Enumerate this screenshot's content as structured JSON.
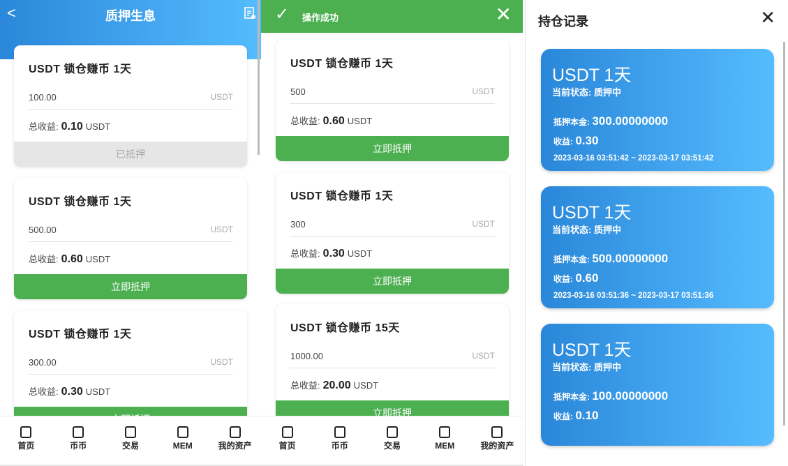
{
  "left": {
    "title": "质押生息",
    "back": "<",
    "cards": [
      {
        "title": "USDT 锁仓赚币 1天",
        "amount": "100.00",
        "unit": "USDT",
        "income_label": "总收益:",
        "income": "0.10",
        "income_unit": "USDT",
        "button": "已抵押",
        "done": true
      },
      {
        "title": "USDT 锁仓赚币 1天",
        "amount": "500.00",
        "unit": "USDT",
        "income_label": "总收益:",
        "income": "0.60",
        "income_unit": "USDT",
        "button": "立即抵押",
        "done": false
      },
      {
        "title": "USDT 锁仓赚币 1天",
        "amount": "300.00",
        "unit": "USDT",
        "income_label": "总收益:",
        "income": "0.30",
        "income_unit": "USDT",
        "button": "立即抵押",
        "done": false
      }
    ]
  },
  "middle": {
    "toast": "操作成功",
    "toast_icon": "✓",
    "close": "✕",
    "cards": [
      {
        "title": "USDT 锁仓赚币 1天",
        "amount": "500",
        "unit": "USDT",
        "income_label": "总收益:",
        "income": "0.60",
        "income_unit": "USDT",
        "button": "立即抵押",
        "done": false
      },
      {
        "title": "USDT 锁仓赚币 1天",
        "amount": "300",
        "unit": "USDT",
        "income_label": "总收益:",
        "income": "0.30",
        "income_unit": "USDT",
        "button": "立即抵押",
        "done": false
      },
      {
        "title": "USDT 锁仓赚币 15天",
        "amount": "1000.00",
        "unit": "USDT",
        "income_label": "总收益:",
        "income": "20.00",
        "income_unit": "USDT",
        "button": "立即抵押",
        "done": false
      }
    ]
  },
  "nav": [
    {
      "label": "首页",
      "icon": "home-icon"
    },
    {
      "label": "币币",
      "icon": "exchange-icon"
    },
    {
      "label": "交易",
      "icon": "trade-icon"
    },
    {
      "label": "MEM",
      "icon": "mem-icon"
    },
    {
      "label": "我的资产",
      "icon": "wallet-icon"
    }
  ],
  "right": {
    "title": "持仓记录",
    "close": "✕",
    "records": [
      {
        "name": "USDT 1天",
        "status": "当前状态: 质押中",
        "principal_label": "抵押本金:",
        "principal": "300.00000000",
        "income_label": "收益:",
        "income": "0.30",
        "period": "2023-03-16 03:51:42 ~ 2023-03-17 03:51:42"
      },
      {
        "name": "USDT 1天",
        "status": "当前状态: 质押中",
        "principal_label": "抵押本金:",
        "principal": "500.00000000",
        "income_label": "收益:",
        "income": "0.60",
        "period": "2023-03-16 03:51:36 ~ 2023-03-17 03:51:36"
      },
      {
        "name": "USDT 1天",
        "status": "当前状态: 质押中",
        "principal_label": "抵押本金:",
        "principal": "100.00000000",
        "income_label": "收益:",
        "income": "0.10",
        "period": ""
      }
    ]
  }
}
